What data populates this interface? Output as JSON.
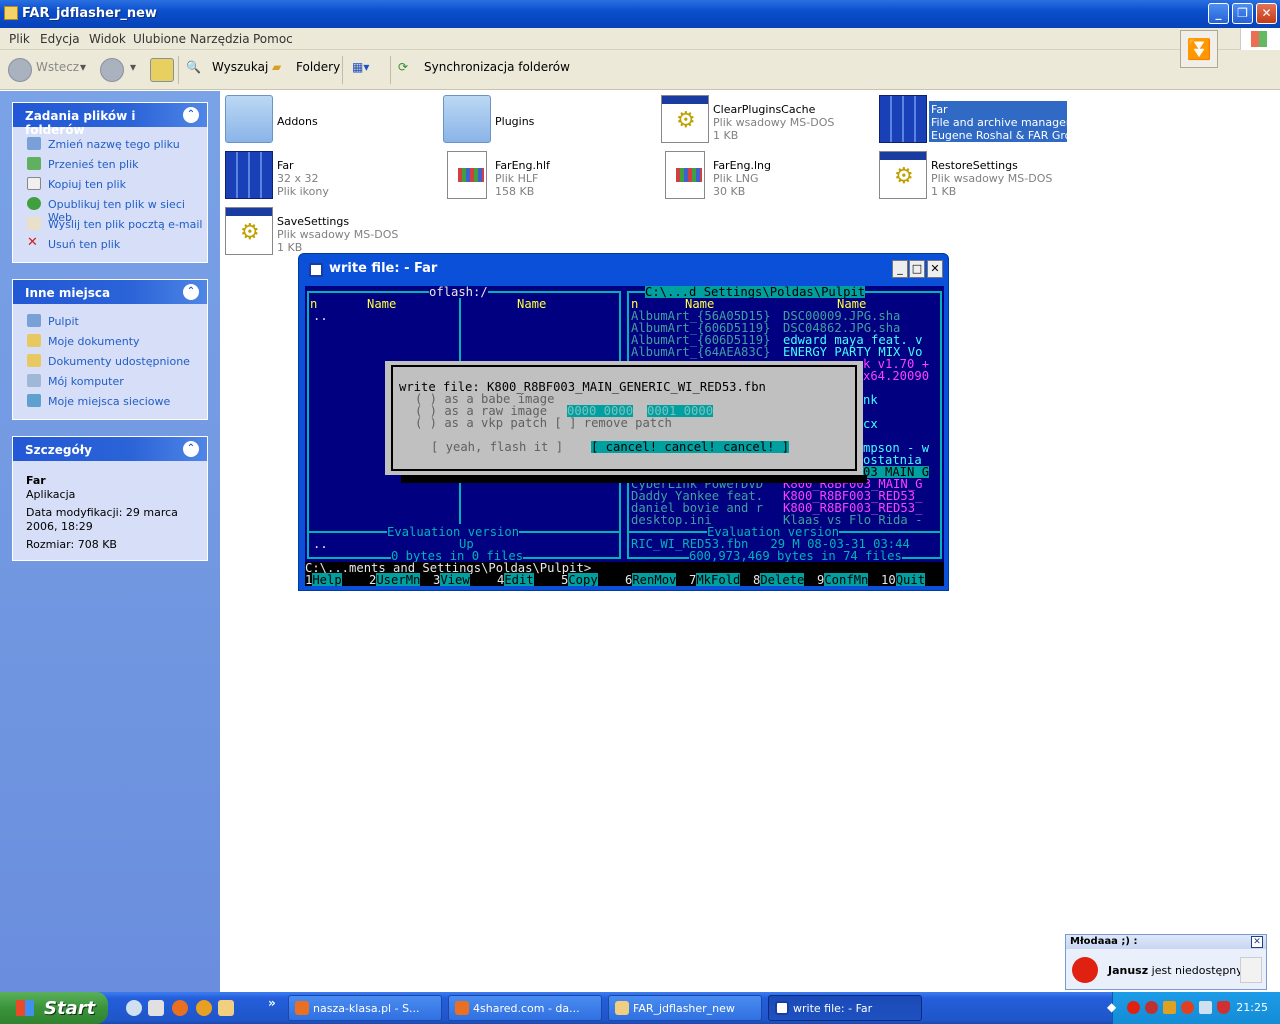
{
  "window": {
    "title": "FAR_jdflasher_new"
  },
  "menu": [
    "Plik",
    "Edycja",
    "Widok",
    "Ulubione",
    "Narzędzia",
    "Pomoc"
  ],
  "toolbar": {
    "back": "Wstecz",
    "search": "Wyszukaj",
    "folders": "Foldery",
    "sync": "Synchronizacja folderów"
  },
  "tasks_panel": {
    "title": "Zadania plików i folderów",
    "items": [
      "Zmień nazwę tego pliku",
      "Przenieś ten plik",
      "Kopiuj ten plik",
      "Opublikuj ten plik w sieci Web",
      "Wyślij ten plik pocztą e-mail",
      "Usuń ten plik"
    ]
  },
  "places_panel": {
    "title": "Inne miejsca",
    "items": [
      "Pulpit",
      "Moje dokumenty",
      "Dokumenty udostępnione",
      "Mój komputer",
      "Moje miejsca sieciowe"
    ]
  },
  "details_panel": {
    "title": "Szczegóły",
    "name": "Far",
    "type": "Aplikacja",
    "modified": "Data modyfikacji: 29 marca 2006, 18:29",
    "size": "Rozmiar: 708 KB"
  },
  "files": [
    {
      "name": "Addons",
      "l2": "",
      "l3": ""
    },
    {
      "name": "Plugins",
      "l2": "",
      "l3": ""
    },
    {
      "name": "ClearPluginsCache",
      "l2": "Plik wsadowy MS-DOS",
      "l3": "1 KB"
    },
    {
      "name": "Far",
      "l2": "File and archive manager",
      "l3": "Eugene Roshal & FAR Group"
    },
    {
      "name": "Far",
      "l2": "32 x 32",
      "l3": "Plik ikony"
    },
    {
      "name": "FarEng.hlf",
      "l2": "Plik HLF",
      "l3": "158 KB"
    },
    {
      "name": "FarEng.lng",
      "l2": "Plik LNG",
      "l3": "30 KB"
    },
    {
      "name": "RestoreSettings",
      "l2": "Plik wsadowy MS-DOS",
      "l3": "1 KB"
    },
    {
      "name": "SaveSettings",
      "l2": "Plik wsadowy MS-DOS",
      "l3": "1 KB"
    }
  ],
  "far": {
    "title": "write file: - Far",
    "left_header": "oflash:/",
    "right_header": "C:\\...d Settings\\Poldas\\Pulpit",
    "col_n": "n",
    "col_name": "Name",
    "updir": "..",
    "right_rows": [
      [
        "AlbumArt_{56A05D15}",
        "DSC00009.JPG.sha"
      ],
      [
        "AlbumArt_{606D5119}",
        "DSC04862.JPG.sha"
      ],
      [
        "AlbumArt_{606D5119}",
        "edward maya feat. v"
      ],
      [
        "AlbumArt_{64AEA83C}",
        "ENERGY PARTY MIX Vo"
      ]
    ],
    "right_partial": [
      "k v1.70 +",
      "x64.20090",
      "nk",
      "cx",
      "mpson - w",
      "ostatnia",
      "03_MAIN_G"
    ],
    "right_rows2": [
      [
        "CyberLink PowerDVD",
        "K800_R8BF003_MAIN_G"
      ],
      [
        "Daddy Yankee feat.",
        "K800_R8BF003_RED53_"
      ],
      [
        "daniel bovie and r",
        "K800_R8BF003_RED53_"
      ],
      [
        "desktop.ini",
        "Klaas vs Flo Rida -"
      ]
    ],
    "eval": "Evaluation version",
    "left_up": "Up",
    "left_bytes": "0 bytes in 0 files",
    "right_file": "RIC_WI_RED53.fbn   29 M 08-03-31 03:44",
    "right_bytes": "600,973,469 bytes in 74 files",
    "prompt": "C:\\...ments and Settings\\Poldas\\Pulpit>",
    "dialog": {
      "title": "write file: K800_R8BF003_MAIN_GENERIC_WI_RED53.fbn",
      "opt1": "( ) as a babe image",
      "opt2": "( ) as a raw image",
      "raw_a": "0000 0000",
      "raw_b": "0001 0000",
      "opt3": "( ) as a vkp patch [ ] remove patch",
      "yes": "[ yeah, flash it ]",
      "cancel": "[ cancel! cancel! cancel! ]"
    },
    "keys": [
      [
        "1",
        "Help"
      ],
      [
        "2",
        "UserMn"
      ],
      [
        "3",
        "View"
      ],
      [
        "4",
        "Edit"
      ],
      [
        "5",
        "Copy"
      ],
      [
        "6",
        "RenMov"
      ],
      [
        "7",
        "MkFold"
      ],
      [
        "8",
        "Delete"
      ],
      [
        "9",
        "ConfMn"
      ],
      [
        "10",
        "Quit"
      ]
    ]
  },
  "notification": {
    "header": "Młodaaa ;) :",
    "name": "Janusz",
    "status": "jest niedostępny"
  },
  "taskbar": {
    "start": "Start",
    "tasks": [
      "nasza-klasa.pl - S...",
      "4shared.com - da...",
      "FAR_jdflasher_new",
      "write file: - Far"
    ],
    "clock": "21:25"
  }
}
